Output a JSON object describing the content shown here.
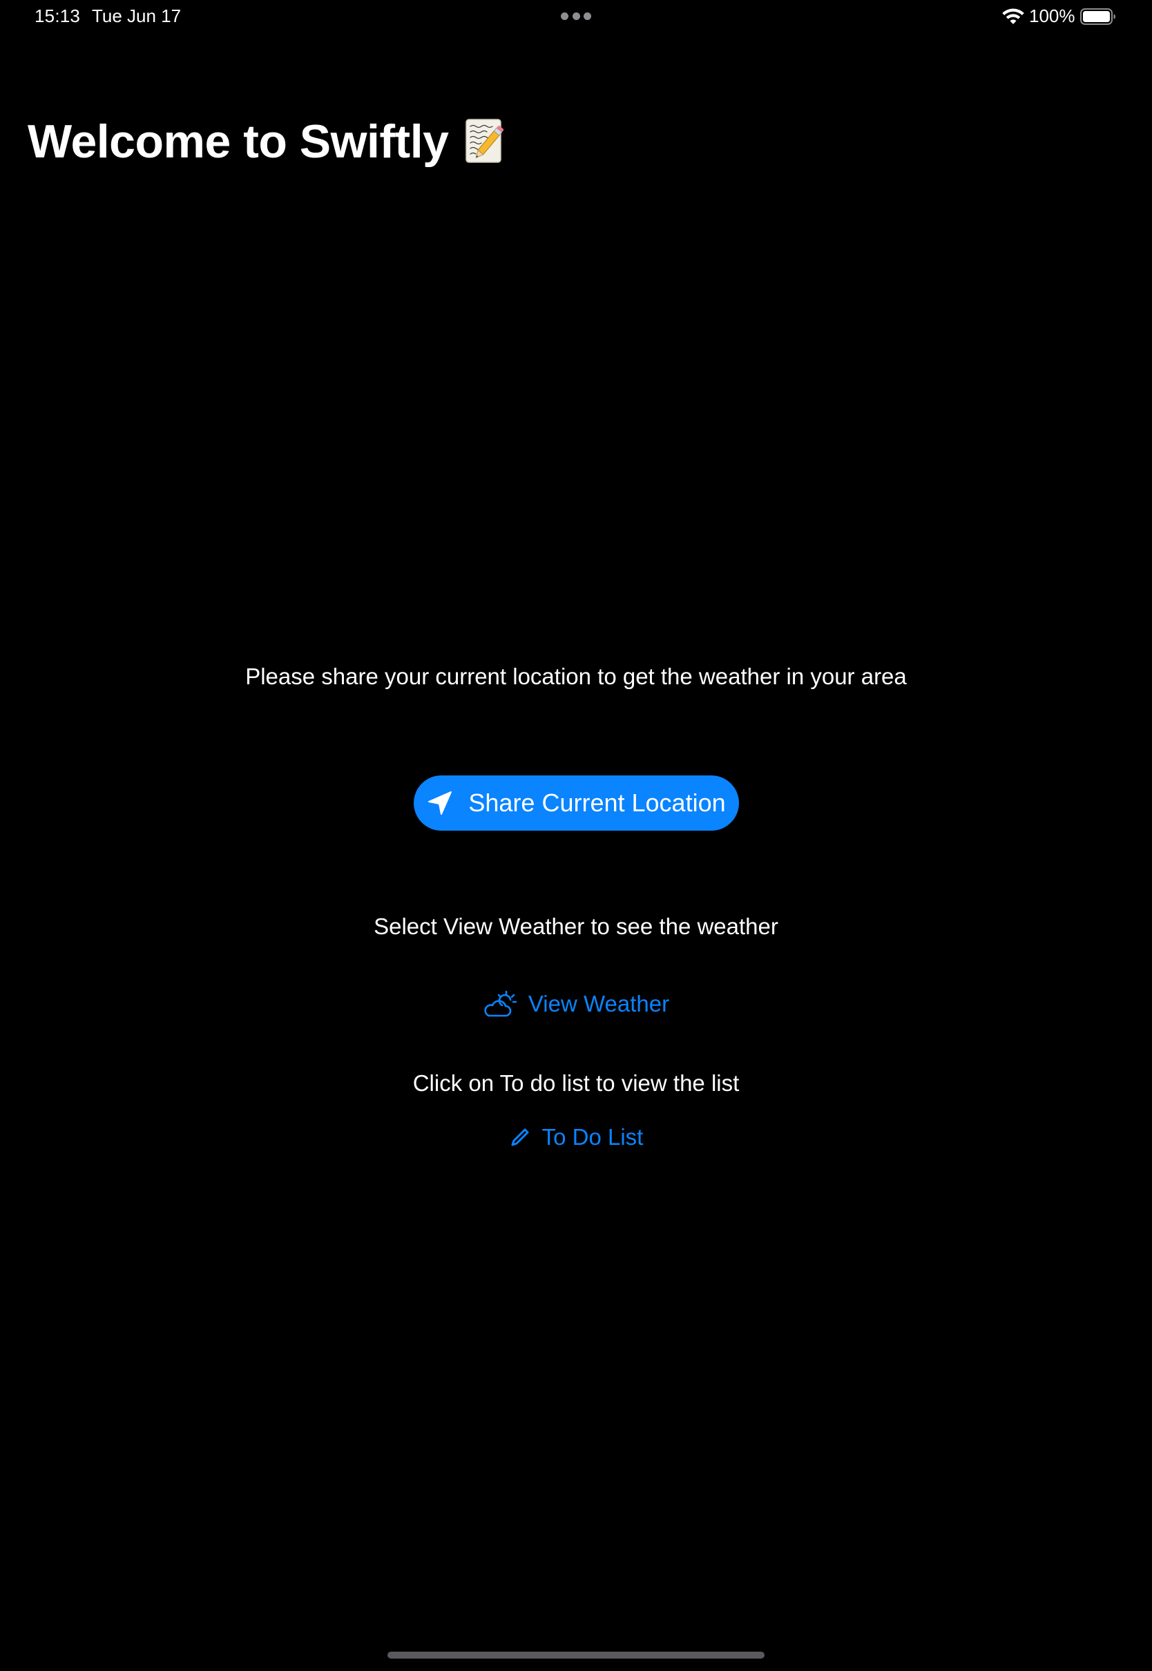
{
  "status_bar": {
    "time": "15:13",
    "date": "Tue Jun 17",
    "battery_percent": "100%",
    "battery_level": 1.0,
    "icons": [
      "multitasking-dots-icon",
      "wifi-icon",
      "battery-icon"
    ]
  },
  "header": {
    "title": "Welcome to Swiftly",
    "title_icon": "memo-icon"
  },
  "location": {
    "prompt": "Please share your current location to get the weather in your area",
    "share_button_label": "Share Current Location",
    "share_button_icon": "location-arrow-icon"
  },
  "weather": {
    "prompt": "Select View Weather to see the weather",
    "button_label": "View Weather",
    "button_icon": "cloud-sun-icon"
  },
  "todo": {
    "prompt": "Click on To do list to view the list",
    "button_label": "To Do List",
    "button_icon": "pencil-icon"
  },
  "colors": {
    "background": "#000000",
    "text": "#ffffff",
    "accent": "#0a84ff"
  }
}
